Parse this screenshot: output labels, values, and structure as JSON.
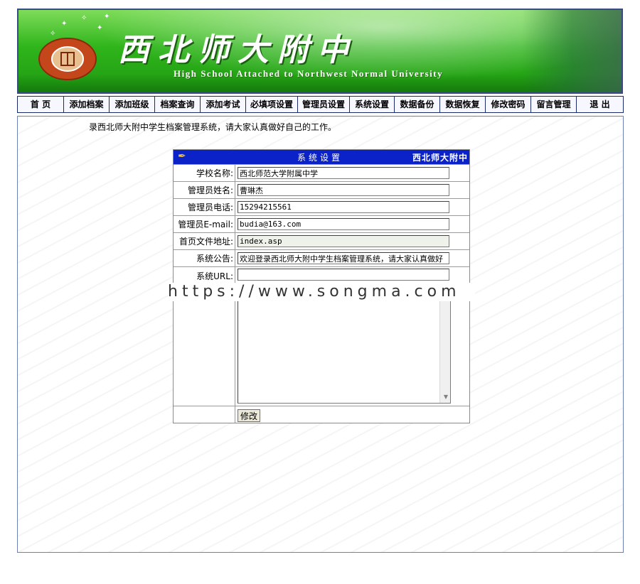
{
  "header": {
    "title": "西北师大附中",
    "subtitle": "High School Attached to Northwest Normal University"
  },
  "nav": {
    "items": [
      "首 页",
      "添加档案",
      "添加班级",
      "档案查询",
      "添加考试",
      "必填项设置",
      "管理员设置",
      "系统设置",
      "数据备份",
      "数据恢复",
      "修改密码",
      "留言管理",
      "退 出"
    ]
  },
  "marquee_text": "录西北师大附中学生档案管理系统，请大家认真做好自己的工作。",
  "panel": {
    "title": "系统设置",
    "school_tag": "西北师大附中",
    "fields": {
      "school_name": {
        "label": "学校名称:",
        "value": "西北师范大学附属中学"
      },
      "admin_name": {
        "label": "管理员姓名:",
        "value": "曹琳杰"
      },
      "admin_phone": {
        "label": "管理员电话:",
        "value": "15294215561"
      },
      "admin_email": {
        "label": "管理员E-mail:",
        "value": "budia@163.com"
      },
      "homepage": {
        "label": "首页文件地址:",
        "value": "index.asp"
      },
      "notice": {
        "label": "系统公告:",
        "value": "欢迎登录西北师大附中学生档案管理系统，请大家认真做好"
      },
      "url": {
        "label": "系统URL:",
        "value": ""
      }
    },
    "submit_label": "修改"
  },
  "overlay_watermark": "https://www.songma.com",
  "colors": {
    "banner_green": "#2fb51b",
    "panel_header_blue": "#0b22c8",
    "border_navy": "#1a2a6a"
  }
}
